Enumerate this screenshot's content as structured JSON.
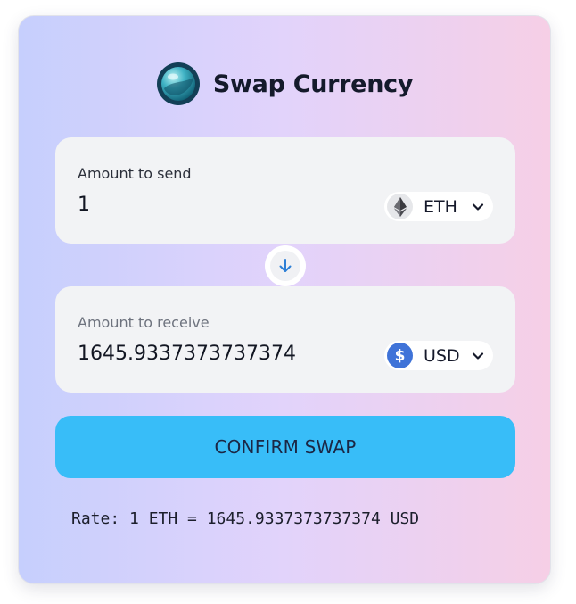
{
  "header": {
    "title": "Swap Currency",
    "logo_icon": "globe-logo-icon"
  },
  "send": {
    "label": "Amount to send",
    "value": "1",
    "currency": {
      "code": "ETH",
      "icon": "ethereum-icon"
    }
  },
  "swap_direction": {
    "icon": "arrow-down-icon"
  },
  "receive": {
    "label": "Amount to receive",
    "value": "1645.9337373737374",
    "currency": {
      "code": "USD",
      "icon": "dollar-icon",
      "icon_glyph": "$"
    }
  },
  "confirm": {
    "label": "CONFIRM SWAP"
  },
  "rate": {
    "text": "Rate: 1 ETH = 1645.9337373737374 USD"
  },
  "colors": {
    "accent": "#38bdf8",
    "usd_badge": "#3f73d8",
    "gradient_start": "#c6cffd",
    "gradient_end": "#f6cfe6"
  }
}
